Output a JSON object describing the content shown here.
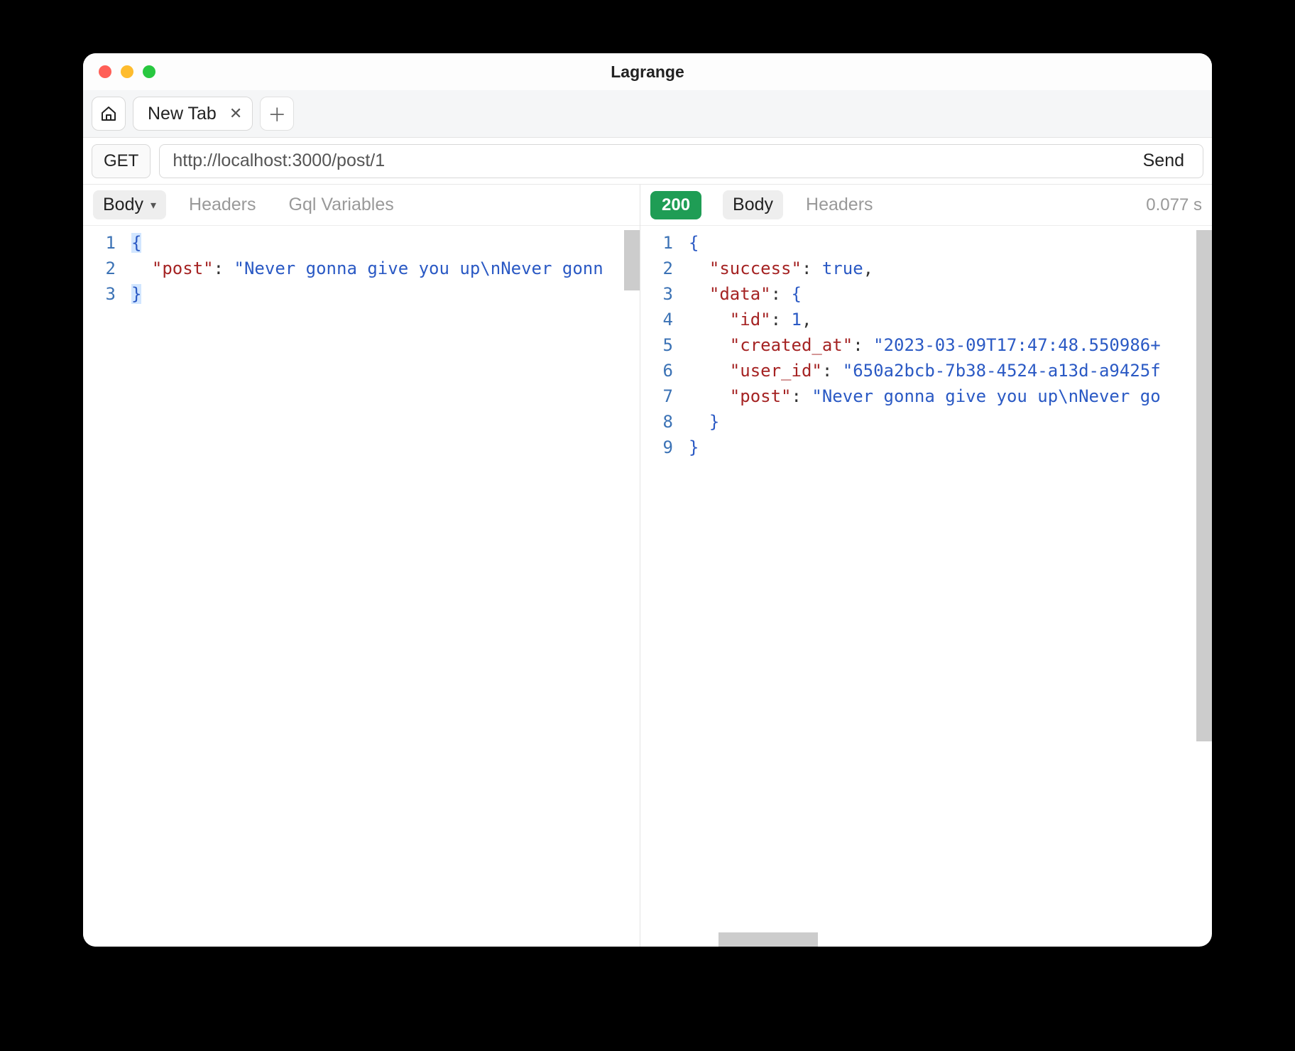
{
  "window": {
    "title": "Lagrange"
  },
  "tabs": {
    "active_label": "New Tab"
  },
  "request": {
    "method": "GET",
    "url": "http://localhost:3000/post/1",
    "send_label": "Send"
  },
  "request_pane": {
    "tabs": {
      "body": "Body",
      "headers": "Headers",
      "gql": "Gql Variables"
    },
    "body_lines": [
      [
        {
          "t": "brace",
          "v": "{"
        }
      ],
      [
        {
          "t": "indent",
          "v": "  "
        },
        {
          "t": "key",
          "v": "\"post\""
        },
        {
          "t": "punc",
          "v": ": "
        },
        {
          "t": "str",
          "v": "\"Never gonna give you up\\nNever gonn"
        }
      ],
      [
        {
          "t": "brace",
          "v": "}"
        }
      ]
    ]
  },
  "response_pane": {
    "status": "200",
    "timing": "0.077 s",
    "tabs": {
      "body": "Body",
      "headers": "Headers"
    },
    "body_lines": [
      [
        {
          "t": "brace",
          "v": "{"
        }
      ],
      [
        {
          "t": "indent",
          "v": "  "
        },
        {
          "t": "key",
          "v": "\"success\""
        },
        {
          "t": "punc",
          "v": ": "
        },
        {
          "t": "bool",
          "v": "true"
        },
        {
          "t": "punc",
          "v": ","
        }
      ],
      [
        {
          "t": "indent",
          "v": "  "
        },
        {
          "t": "key",
          "v": "\"data\""
        },
        {
          "t": "punc",
          "v": ": "
        },
        {
          "t": "brace",
          "v": "{"
        }
      ],
      [
        {
          "t": "indent",
          "v": "    "
        },
        {
          "t": "key",
          "v": "\"id\""
        },
        {
          "t": "punc",
          "v": ": "
        },
        {
          "t": "num",
          "v": "1"
        },
        {
          "t": "punc",
          "v": ","
        }
      ],
      [
        {
          "t": "indent",
          "v": "    "
        },
        {
          "t": "key",
          "v": "\"created_at\""
        },
        {
          "t": "punc",
          "v": ": "
        },
        {
          "t": "str",
          "v": "\"2023-03-09T17:47:48.550986+"
        }
      ],
      [
        {
          "t": "indent",
          "v": "    "
        },
        {
          "t": "key",
          "v": "\"user_id\""
        },
        {
          "t": "punc",
          "v": ": "
        },
        {
          "t": "str",
          "v": "\"650a2bcb-7b38-4524-a13d-a9425f"
        }
      ],
      [
        {
          "t": "indent",
          "v": "    "
        },
        {
          "t": "key",
          "v": "\"post\""
        },
        {
          "t": "punc",
          "v": ": "
        },
        {
          "t": "str",
          "v": "\"Never gonna give you up\\nNever go"
        }
      ],
      [
        {
          "t": "indent",
          "v": "  "
        },
        {
          "t": "brace",
          "v": "}"
        }
      ],
      [
        {
          "t": "brace",
          "v": "}"
        }
      ]
    ]
  }
}
